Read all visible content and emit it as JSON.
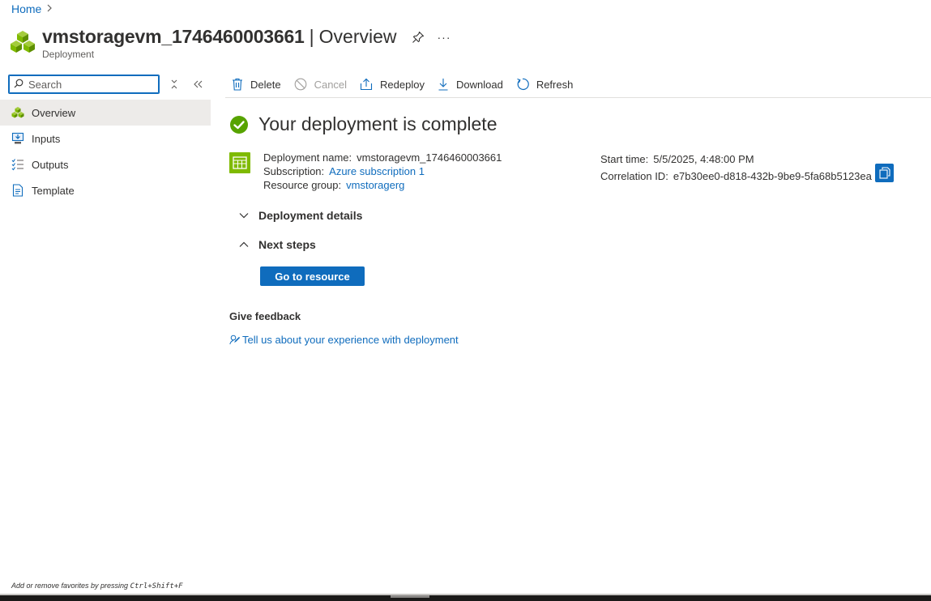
{
  "breadcrumb": {
    "home": "Home",
    "chevron": "›"
  },
  "header": {
    "name": "vmstoragevm_1746460003661",
    "separator": "|",
    "page": "Overview",
    "subtitle": "Deployment",
    "more": "···"
  },
  "sidebar": {
    "search_placeholder": "Search",
    "items": [
      {
        "label": "Overview",
        "icon": "deployment-cubes-icon"
      },
      {
        "label": "Inputs",
        "icon": "inputs-icon"
      },
      {
        "label": "Outputs",
        "icon": "outputs-icon"
      },
      {
        "label": "Template",
        "icon": "template-icon"
      }
    ]
  },
  "toolbar": {
    "delete": "Delete",
    "cancel": "Cancel",
    "redeploy": "Redeploy",
    "download": "Download",
    "refresh": "Refresh"
  },
  "status": {
    "title": "Your deployment is complete"
  },
  "details": {
    "deployment_name_label": "Deployment name:",
    "deployment_name": "vmstoragevm_1746460003661",
    "subscription_label": "Subscription:",
    "subscription": "Azure subscription 1",
    "resource_group_label": "Resource group:",
    "resource_group": "vmstoragerg",
    "start_time_label": "Start time:",
    "start_time": "5/5/2025, 4:48:00 PM",
    "correlation_label": "Correlation ID:",
    "correlation_id": "e7b30ee0-d818-432b-9be9-5fa68b5123ea"
  },
  "sections": {
    "deployment_details": "Deployment details",
    "next_steps": "Next steps",
    "go_to_resource": "Go to resource"
  },
  "feedback": {
    "title": "Give feedback",
    "link": "Tell us about your experience with deployment"
  },
  "footer": {
    "hint_prefix": "Add or remove favorites by pressing ",
    "hint_keys": "Ctrl+Shift+F"
  },
  "colors": {
    "accent": "#0f6cbd",
    "success": "#57a300",
    "deployment_icon": "#7fba00"
  }
}
